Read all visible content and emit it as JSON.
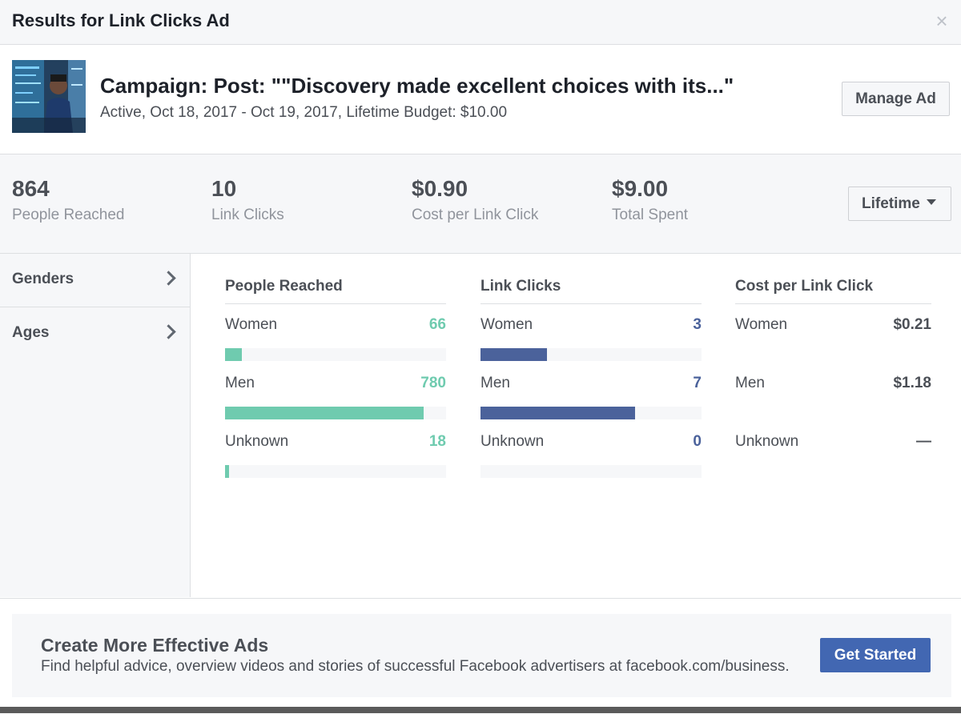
{
  "dialog": {
    "title": "Results for Link Clicks Ad",
    "close_icon": "close-icon"
  },
  "ad": {
    "campaign_title": "Campaign: Post: \"\"Discovery made excellent choices with its...\"",
    "status_line": "Active, Oct 18, 2017 - Oct 19, 2017, Lifetime Budget: $10.00",
    "manage_label": "Manage Ad"
  },
  "stats": [
    {
      "value": "864",
      "label": "People Reached"
    },
    {
      "value": "10",
      "label": "Link Clicks"
    },
    {
      "value": "$0.90",
      "label": "Cost per Link Click"
    },
    {
      "value": "$9.00",
      "label": "Total Spent"
    }
  ],
  "period_select": {
    "selected": "Lifetime"
  },
  "sidebar": {
    "items": [
      {
        "label": "Genders"
      },
      {
        "label": "Ages"
      }
    ]
  },
  "breakdown": {
    "people_reached": {
      "title": "People Reached",
      "rows": [
        {
          "label": "Women",
          "value": "66",
          "fraction": 0.076
        },
        {
          "label": "Men",
          "value": "780",
          "fraction": 0.9
        },
        {
          "label": "Unknown",
          "value": "18",
          "fraction": 0.018
        }
      ]
    },
    "link_clicks": {
      "title": "Link Clicks",
      "rows": [
        {
          "label": "Women",
          "value": "3",
          "fraction": 0.3
        },
        {
          "label": "Men",
          "value": "7",
          "fraction": 0.7
        },
        {
          "label": "Unknown",
          "value": "0",
          "fraction": 0
        }
      ]
    },
    "cost_per_link_click": {
      "title": "Cost per Link Click",
      "rows": [
        {
          "label": "Women",
          "value": "$0.21"
        },
        {
          "label": "Men",
          "value": "$1.18"
        },
        {
          "label": "Unknown",
          "value": "—"
        }
      ]
    }
  },
  "promo": {
    "title": "Create More Effective Ads",
    "text": "Find helpful advice, overview videos and stories of successful Facebook advertisers at facebook.com/business.",
    "button_label": "Get Started"
  },
  "colors": {
    "reach_bar": "#6fcbaf",
    "clicks_bar": "#4b629b",
    "primary_button": "#4267b2"
  }
}
